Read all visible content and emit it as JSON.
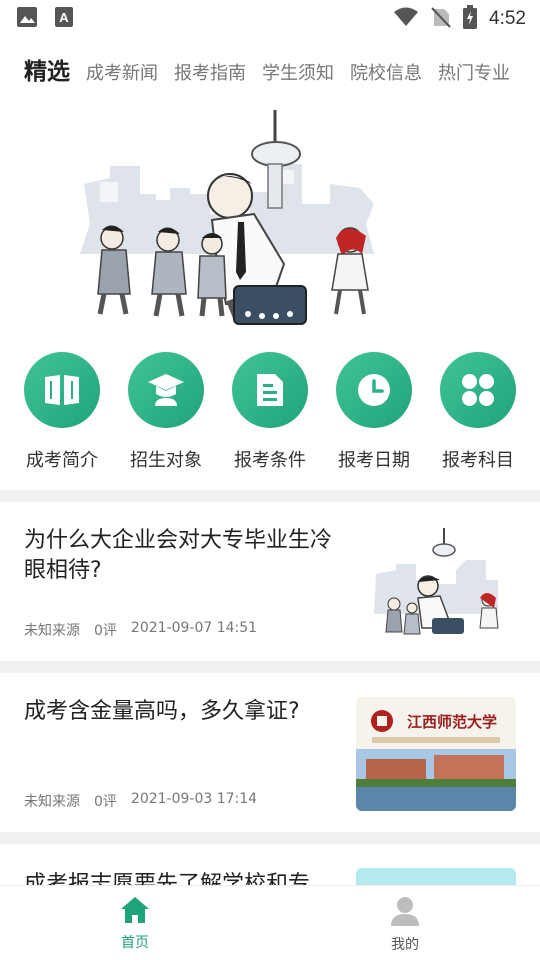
{
  "status_bar": {
    "time": "4:52",
    "left_icons": [
      "gallery-icon",
      "font-a-icon"
    ],
    "right_icons": [
      "wifi-icon",
      "no-sim-icon",
      "battery-icon"
    ]
  },
  "tabs": [
    {
      "label": "精选",
      "active": true
    },
    {
      "label": "成考新闻",
      "active": false
    },
    {
      "label": "报考指南",
      "active": false
    },
    {
      "label": "学生须知",
      "active": false
    },
    {
      "label": "院校信息",
      "active": false
    },
    {
      "label": "热门专业",
      "active": false
    }
  ],
  "categories": [
    {
      "label": "成考简介",
      "icon": "book-icon"
    },
    {
      "label": "招生对象",
      "icon": "graduate-icon"
    },
    {
      "label": "报考条件",
      "icon": "document-icon"
    },
    {
      "label": "报考日期",
      "icon": "clock-icon"
    },
    {
      "label": "报考科目",
      "icon": "grid-icon"
    }
  ],
  "articles": [
    {
      "title": "为什么大企业会对大专毕业生冷眼相待?",
      "source": "未知来源",
      "comments": "0评",
      "date": "2021-09-07 14:51"
    },
    {
      "title": "成考含金量高吗，多久拿证?",
      "source": "未知来源",
      "comments": "0评",
      "date": "2021-09-03 17:14",
      "thumb_text": "江西师范大学"
    },
    {
      "title": "成考报志愿要先了解学校和专"
    }
  ],
  "bottom_nav": [
    {
      "label": "首页",
      "icon": "home-icon",
      "active": true
    },
    {
      "label": "我的",
      "icon": "profile-icon",
      "active": false
    }
  ],
  "colors": {
    "accent": "#1fa37a",
    "divider": "#f1f1f1"
  }
}
